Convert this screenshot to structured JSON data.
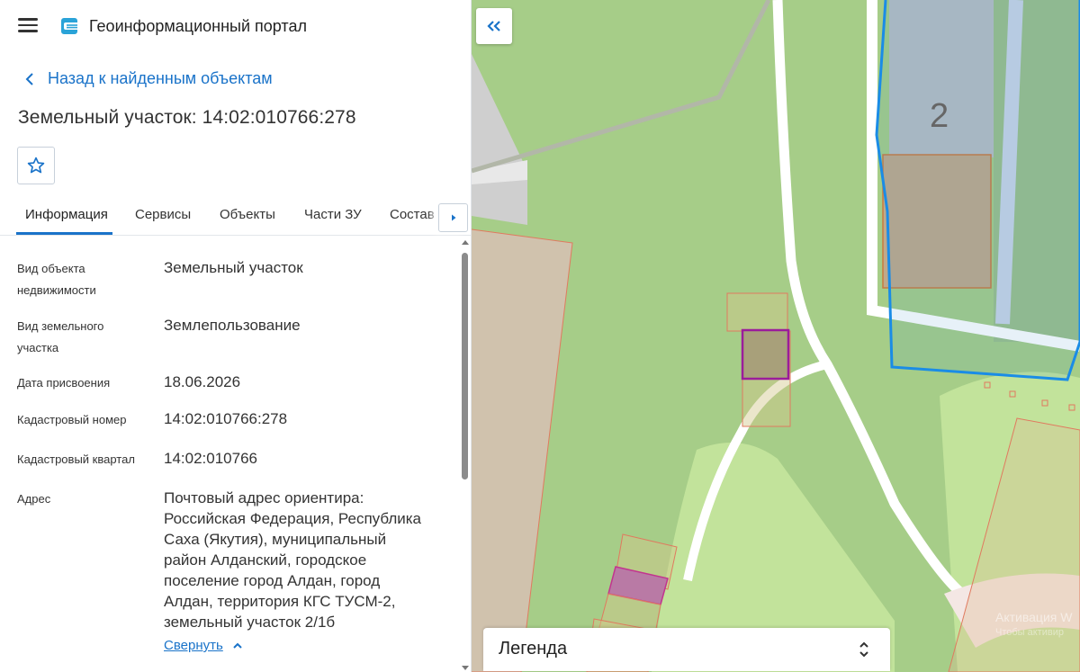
{
  "header": {
    "title": "Геоинформационный портал"
  },
  "nav": {
    "back_label": "Назад к найденным объектам"
  },
  "object": {
    "title": "Земельный участок: 14:02:010766:278"
  },
  "tabs": [
    {
      "label": "Информация",
      "active": true
    },
    {
      "label": "Сервисы",
      "active": false
    },
    {
      "label": "Объекты",
      "active": false
    },
    {
      "label": "Части ЗУ",
      "active": false
    },
    {
      "label": "Состав",
      "active": false
    }
  ],
  "properties": [
    {
      "label_lines": [
        "Вид объекта",
        "недвижимости"
      ],
      "value": "Земельный участок"
    },
    {
      "label_lines": [
        "Вид земельного",
        "участка"
      ],
      "value": "Землепользование"
    },
    {
      "label_lines": [
        "Дата присвоения"
      ],
      "value": "18.06.2026"
    },
    {
      "label_lines": [
        "Кадастровый номер"
      ],
      "value": "14:02:010766:278"
    },
    {
      "label_lines": [
        "Кадастровый квартал"
      ],
      "value": "14:02:010766"
    },
    {
      "label_lines": [
        "Адрес"
      ],
      "value_lines": [
        "Почтовый адрес ориентира:",
        "Российская Федерация, Республика",
        "Саха (Якутия), муниципальный",
        "район Алданский, городское",
        "поселение город Алдан, город",
        "Алдан, территория КГС ТУСМ-2,",
        "земельный участок 2/1б"
      ]
    }
  ],
  "collapse_label": "Свернуть",
  "map": {
    "building_number": "2",
    "legend_label": "Легенда",
    "watermark_line1": "Активация W",
    "watermark_line2": "Чтобы активир"
  },
  "colors": {
    "accent": "#1a73c9",
    "map_green": "#a8cf8a",
    "selected_parcel": "#9b1c9b",
    "boundary_blue": "#1a8ce6"
  },
  "icons": {
    "menu": "hamburger-icon",
    "logo": "portal-logo-icon",
    "back": "chevron-left-icon",
    "favorite": "star-icon",
    "tabs_scroll": "caret-right-icon",
    "collapse_panel": "double-chevron-left-icon",
    "legend_toggle": "unfold-icon",
    "collapse": "chevron-up-icon"
  }
}
